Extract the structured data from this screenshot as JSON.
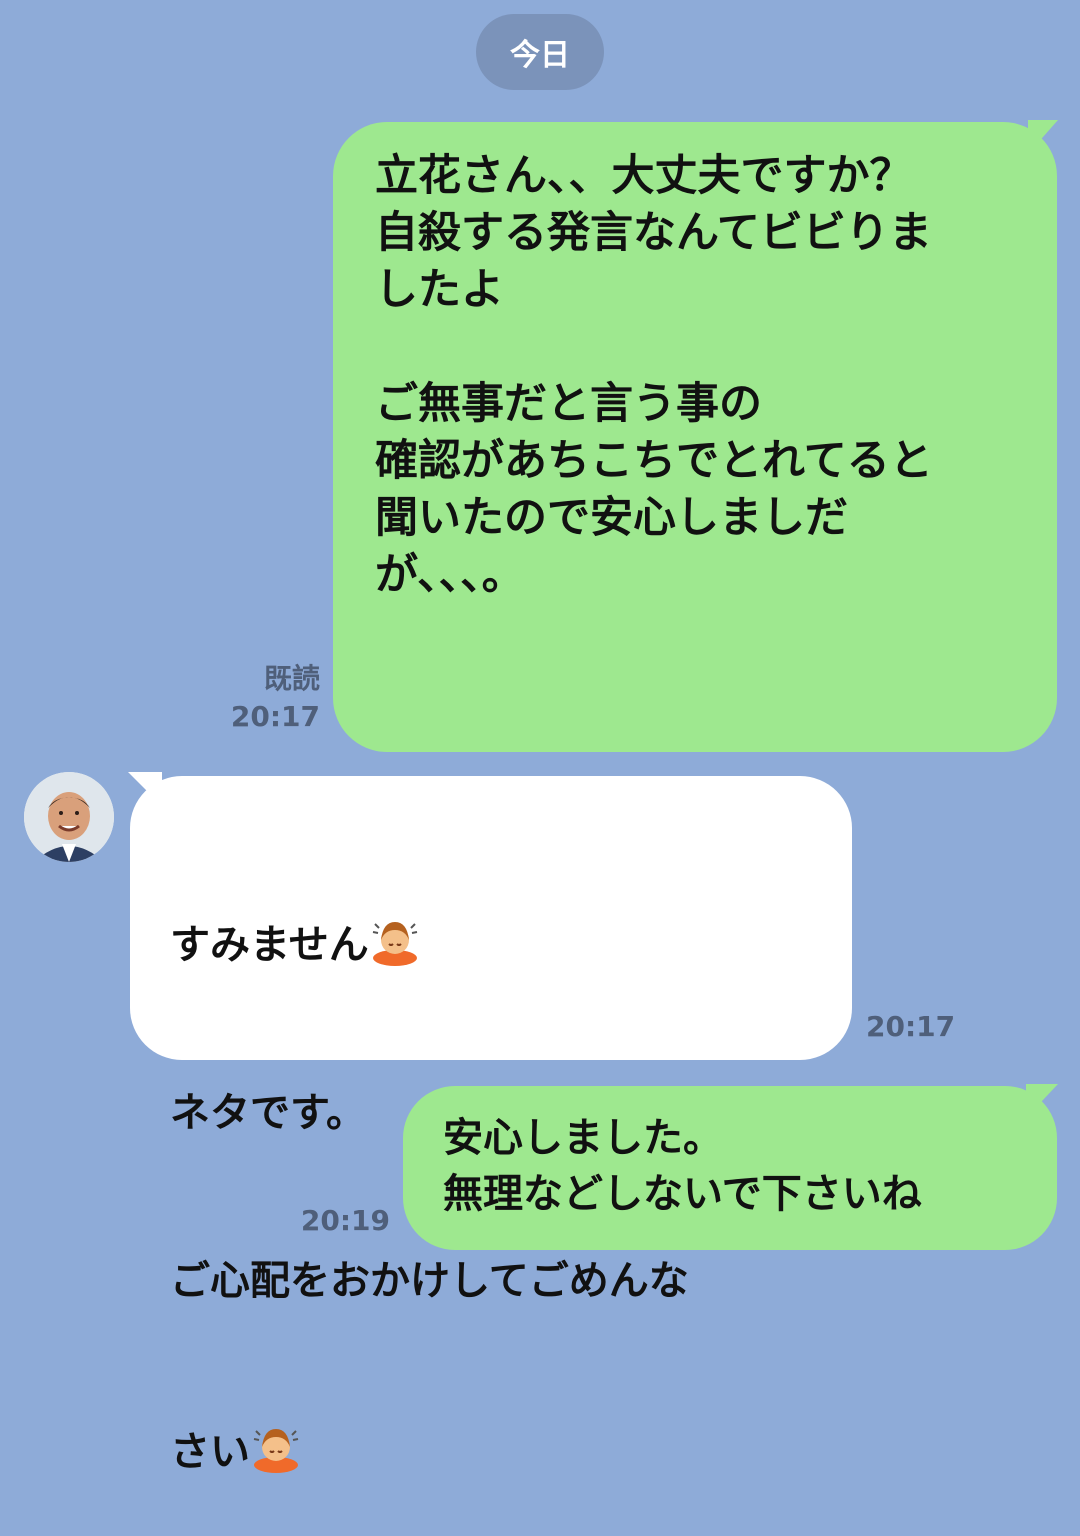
{
  "chat": {
    "date_label": "今日",
    "messages": [
      {
        "direction": "sent",
        "text": "立花さん、、大丈夫ですか？\n自殺する発言なんてビビりま\nしたよ\n\nご無事だと言う事の\n確認があちこちでとれてると\n聞いたので安心しましだ\nが、、、。",
        "read_label": "既読",
        "time": "20:17"
      },
      {
        "direction": "received",
        "line1": "すみません",
        "line2": "ネタです。",
        "line3": "ご心配をおかけしてごめんな",
        "line4": "さい",
        "emoji": "person-bowing-emoji",
        "time": "20:17"
      },
      {
        "direction": "sent",
        "text": "安心しました。\n無理などしないで下さいね",
        "time": "20:19"
      }
    ]
  },
  "colors": {
    "background": "#8eabd8",
    "sent_bubble": "#9ee88f",
    "received_bubble": "#ffffff",
    "date_pill": "#7b93ba",
    "meta_text": "#4f5f7a"
  }
}
